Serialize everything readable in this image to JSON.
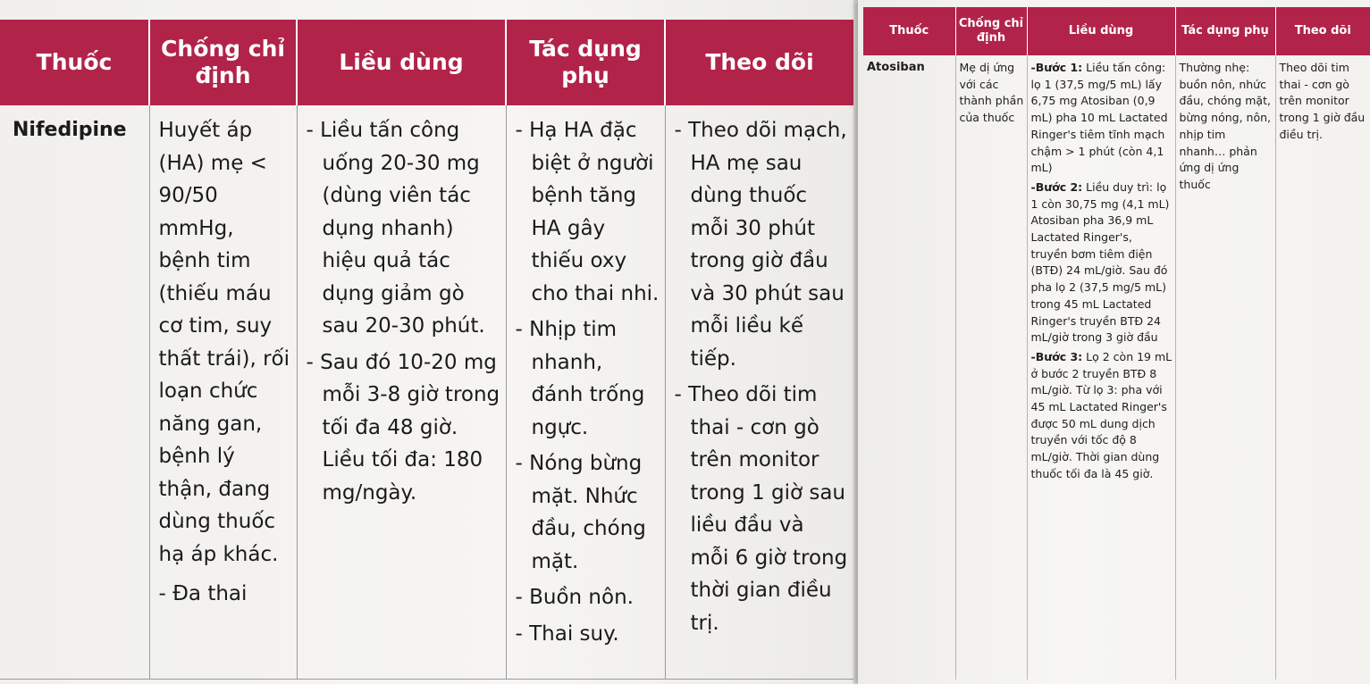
{
  "left_table": {
    "headers": [
      "Thuốc",
      "Chống chỉ định",
      "Liều dùng",
      "Tác dụng phụ",
      "Theo dõi"
    ],
    "row": {
      "drug": "Nifedipine",
      "contraindications": "Huyết áp (HA) mẹ < 90/50 mmHg, bệnh tim (thiếu máu cơ tim, suy thất trái), rối loạn chức năng gan, bệnh lý thận, đang dùng thuốc hạ áp khác.",
      "contraindication_extra": "- Đa thai",
      "dosage": [
        "- Liều tấn công uống 20-30 mg (dùng viên tác dụng nhanh) hiệu quả tác dụng giảm gò sau 20-30 phút.",
        "- Sau đó 10-20 mg mỗi 3-8 giờ trong tối đa 48 giờ. Liều tối đa: 180 mg/ngày."
      ],
      "side_effects": [
        "- Hạ HA đặc biệt ở người bệnh tăng HA gây thiếu oxy cho thai nhi.",
        "- Nhịp tim nhanh, đánh trống ngực.",
        "- Nóng bừng mặt. Nhức đầu, chóng mặt.",
        "- Buồn nôn.",
        "- Thai suy."
      ],
      "monitoring": [
        "- Theo dõi mạch, HA mẹ sau dùng thuốc mỗi 30 phút trong giờ đầu và 30 phút sau mỗi liều kế tiếp.",
        "- Theo dõi tim thai - cơn gò trên monitor trong 1 giờ sau liều đầu và mỗi 6 giờ trong thời gian điều trị."
      ]
    }
  },
  "right_table": {
    "headers": [
      "Thuốc",
      "Chống chỉ định",
      "Liều dùng",
      "Tác dụng phụ",
      "Theo dõi"
    ],
    "row": {
      "drug": "Atosiban",
      "contraindications": "Mẹ dị ứng với các thành phần của thuốc",
      "steps": [
        {
          "label": "-Bước 1:",
          "text": "Liều tấn công: lọ 1 (37,5 mg/5 mL) lấy 6,75 mg Atosiban (0,9 mL) pha 10 mL Lactated Ringer's tiêm tĩnh mạch chậm > 1 phút (còn 4,1 mL)"
        },
        {
          "label": "-Bước 2:",
          "text": "Liều duy trì: lọ 1 còn 30,75 mg (4,1 mL) Atosiban pha 36,9 mL Lactated Ringer's, truyền bơm tiêm điện (BTĐ) 24 mL/giờ. Sau đó pha lọ 2 (37,5 mg/5 mL) trong 45 mL Lactated Ringer's truyền BTĐ 24 mL/giờ trong 3 giờ đầu"
        },
        {
          "label": "-Bước 3:",
          "text": "Lọ 2 còn 19 mL ở bước 2 truyền BTĐ 8 mL/giờ. Từ lọ 3: pha với 45 mL Lactated Ringer's được 50 mL dung dịch truyền với tốc độ 8 mL/giờ. Thời gian dùng thuốc tối đa là 45 giờ."
        }
      ],
      "side_effects": "Thường nhẹ: buồn nôn, nhức đầu, chóng mặt, bừng nóng, nôn, nhịp tim nhanh… phản ứng dị ứng thuốc",
      "monitoring": "Theo dõi tim thai - cơn gò trên monitor trong 1 giờ đầu điều trị."
    }
  },
  "colors": {
    "header_bg": "#b2234a",
    "header_text": "#ffffff",
    "body_text": "#1b1b1b",
    "page_bg": "#f4f3f1"
  }
}
